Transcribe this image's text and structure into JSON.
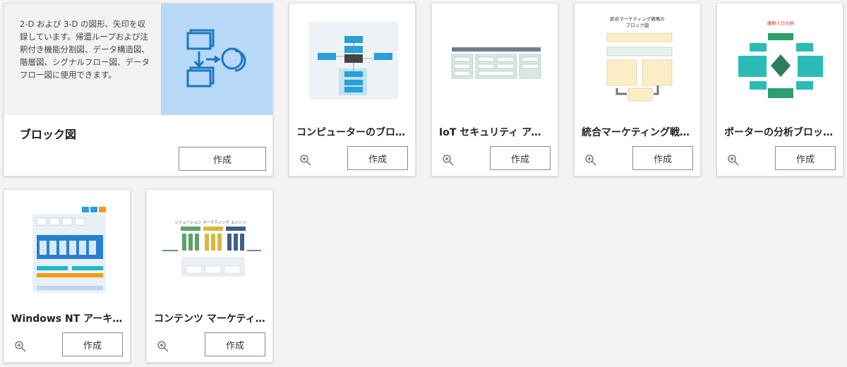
{
  "featured": {
    "description": "2-D および 3-D の図形、矢印を収録しています。帰還ループおよび注釈付き機能分割図、データ構造図、階層図、シグナルフロー図、データ フロー図に使用できます。",
    "title": "ブロック図",
    "create_label": "作成"
  },
  "templates": [
    {
      "title": "コンピューターのブロック図",
      "create_label": "作成"
    },
    {
      "title": "IoT セキュリティ アーキテクチャ",
      "create_label": "作成"
    },
    {
      "title": "統合マーケティング戦略のブロック図",
      "create_label": "作成"
    },
    {
      "title": "ポーターの分析ブロック図",
      "create_label": "作成"
    },
    {
      "title": "Windows NT アーキテクチャ",
      "create_label": "作成"
    },
    {
      "title": "コンテンツ マーケティング エンジン",
      "create_label": "作成"
    }
  ],
  "thumbnails": {
    "marketing_title": "統合マーケティング戦略の\nブロック図",
    "porter_title": "蓮根人の分析",
    "content_title": "ソリューション マーケティング エンジン"
  },
  "icons": {
    "zoom": "zoom-in-icon",
    "featured": "block-diagram-icon"
  },
  "colors": {
    "featured_bg": "#b8d8f7",
    "featured_icon": "#1a78c2",
    "accent_teal": "#2bbcb8",
    "accent_green": "#2e8b57"
  }
}
